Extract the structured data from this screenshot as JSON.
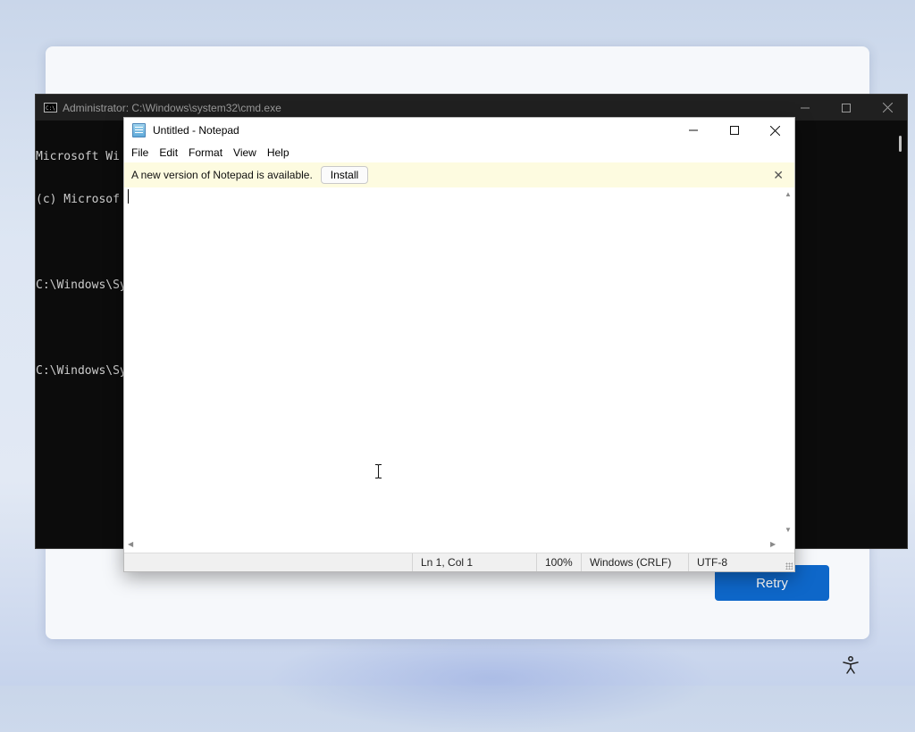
{
  "setup": {
    "retry_label": "Retry",
    "accessibility_icon": "accessibility-icon"
  },
  "cmd": {
    "title": "Administrator: C:\\Windows\\system32\\cmd.exe",
    "icon": "C:\\",
    "lines": [
      "Microsoft Wi",
      "(c) Microsof",
      "",
      "C:\\Windows\\Sy",
      "",
      "C:\\Windows\\Sy"
    ]
  },
  "notepad": {
    "title": "Untitled - Notepad",
    "menus": [
      "File",
      "Edit",
      "Format",
      "View",
      "Help"
    ],
    "banner": {
      "text": "A new version of Notepad is available.",
      "install_label": "Install",
      "close_glyph": "✕"
    },
    "editor_text": "",
    "status": {
      "position": "Ln 1, Col 1",
      "zoom": "100%",
      "line_ending": "Windows (CRLF)",
      "encoding": "UTF-8"
    }
  }
}
